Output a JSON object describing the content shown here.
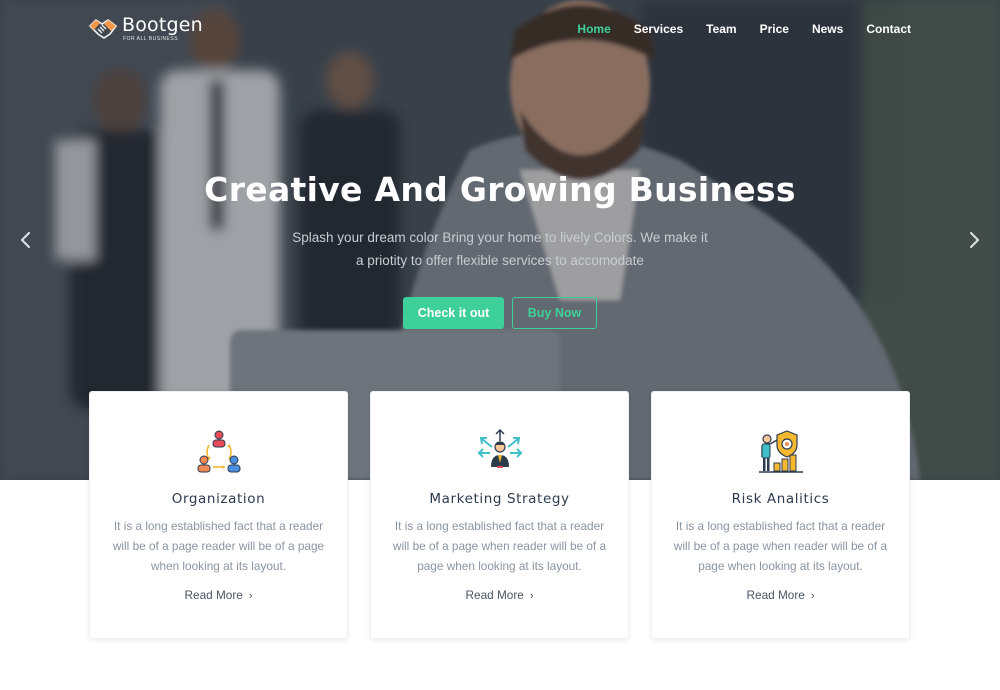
{
  "brand": {
    "name": "Bootgen",
    "tagline": "FOR ALL BUSINESS",
    "accent": "#3ed09a"
  },
  "nav": {
    "items": [
      {
        "label": "Home",
        "active": true
      },
      {
        "label": "Services",
        "active": false
      },
      {
        "label": "Team",
        "active": false
      },
      {
        "label": "Price",
        "active": false
      },
      {
        "label": "News",
        "active": false
      },
      {
        "label": "Contact",
        "active": false
      }
    ]
  },
  "hero": {
    "title": "Creative And Growing Business",
    "subtitle_line1": "Splash your dream color Bring your home to lively Colors. We make it",
    "subtitle_line2": "a priotity to offer flexible services to accomodate",
    "primary_button": "Check it out",
    "secondary_button": "Buy Now"
  },
  "features": [
    {
      "icon": "organization-icon",
      "title": "Organization",
      "text": "It is a long established fact that a reader will be of a page reader will be of a page when looking at its layout.",
      "link": "Read More"
    },
    {
      "icon": "marketing-strategy-icon",
      "title": "Marketing Strategy",
      "text": "It is a long established fact that a reader will be of a page when reader will be of a page when looking at its layout.",
      "link": "Read More"
    },
    {
      "icon": "risk-analytics-icon",
      "title": "Risk Analitics",
      "text": "It is a long established fact that a reader will be of a page when reader will be of a page when looking at its layout.",
      "link": "Read More"
    }
  ]
}
